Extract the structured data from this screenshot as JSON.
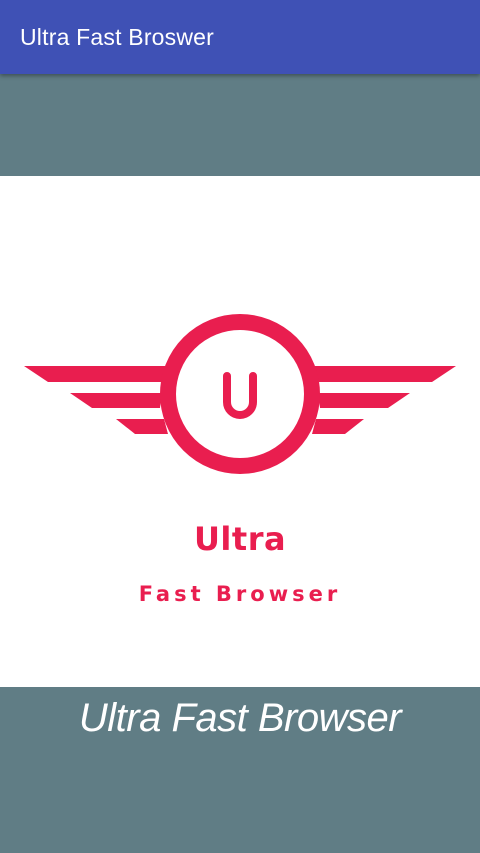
{
  "app_bar": {
    "title": "Ultra Fast Broswer"
  },
  "logo": {
    "icon": "winged-circle-logo-icon",
    "monogram": "U",
    "wordmark": "Ultra",
    "tagline": "Fast Browser"
  },
  "caption": "Ultra Fast Browser",
  "colors": {
    "app_bar": "#3f51b5",
    "background": "#607d85",
    "logo_panel": "#ffffff",
    "brand": "#e91e4f",
    "caption_text": "#ffffff"
  }
}
